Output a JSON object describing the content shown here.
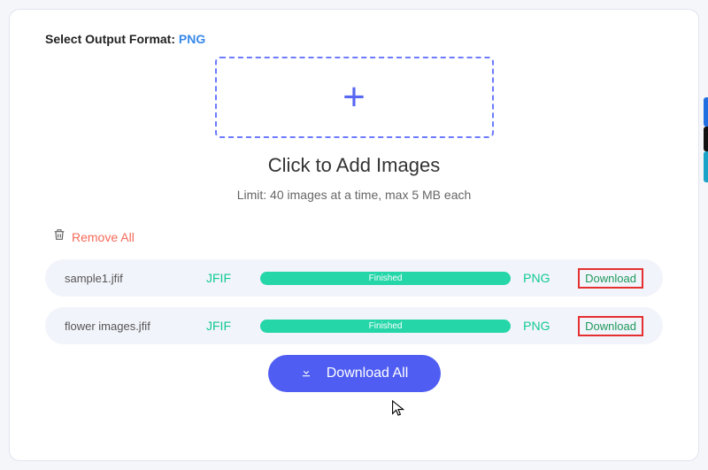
{
  "header": {
    "output_label": "Select Output Format:",
    "output_value": "PNG"
  },
  "dropzone": {
    "title": "Click to Add Images",
    "limit": "Limit: 40 images at a time, max 5 MB each"
  },
  "actions": {
    "remove_all": "Remove All",
    "download_all": "Download All"
  },
  "files": [
    {
      "name": "sample1.jfif",
      "in_fmt": "JFIF",
      "progress_label": "Finished",
      "out_fmt": "PNG",
      "download_label": "Download"
    },
    {
      "name": "flower images.jfif",
      "in_fmt": "JFIF",
      "progress_label": "Finished",
      "out_fmt": "PNG",
      "download_label": "Download"
    }
  ]
}
